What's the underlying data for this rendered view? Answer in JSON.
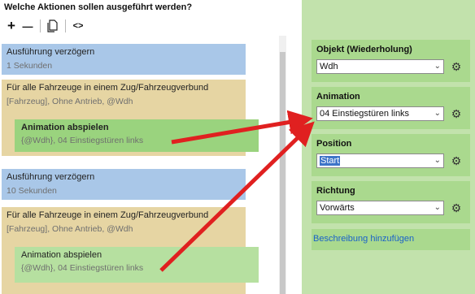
{
  "header": {
    "question": "Welche Aktionen sollen ausgeführt werden?"
  },
  "toolbar": {
    "add": "+",
    "remove": "—",
    "copy_icon": "copy-icon",
    "code": "<>"
  },
  "actions": [
    {
      "title": "Ausführung verzögern",
      "subtitle": "1 Sekunden"
    },
    {
      "title": "Für alle Fahrzeuge in einem Zug/Fahrzeugverbund",
      "subtitle": "[Fahrzeug], Ohne Antrieb, @Wdh"
    },
    {
      "title": "Animation abspielen",
      "subtitle": "{@Wdh}, 04 Einstiegstüren links"
    },
    {
      "title": "Ausführung verzögern",
      "subtitle": "10 Sekunden"
    },
    {
      "title": "Für alle Fahrzeuge in einem Zug/Fahrzeugverbund",
      "subtitle": "[Fahrzeug], Ohne Antrieb, @Wdh"
    },
    {
      "title": "Animation abspielen",
      "subtitle": "{@Wdh}, 04 Einstiegstüren links"
    }
  ],
  "properties": {
    "object": {
      "label": "Objekt (Wiederholung)",
      "value": "Wdh"
    },
    "animation": {
      "label": "Animation",
      "value": "04 Einstiegstüren links"
    },
    "position": {
      "label": "Position",
      "value": "Start"
    },
    "direction": {
      "label": "Richtung",
      "value": "Vorwärts"
    },
    "add_description": "Beschreibung hinzufügen"
  },
  "colors": {
    "delay": "#a9c7e8",
    "loop": "#e6d5a3",
    "animation": "#b6e0a0",
    "panel": "#c2e2ac",
    "arrow": "#e02020"
  },
  "icons": {
    "dropdown": "chevron-down-icon",
    "settings": "gear-icon"
  }
}
